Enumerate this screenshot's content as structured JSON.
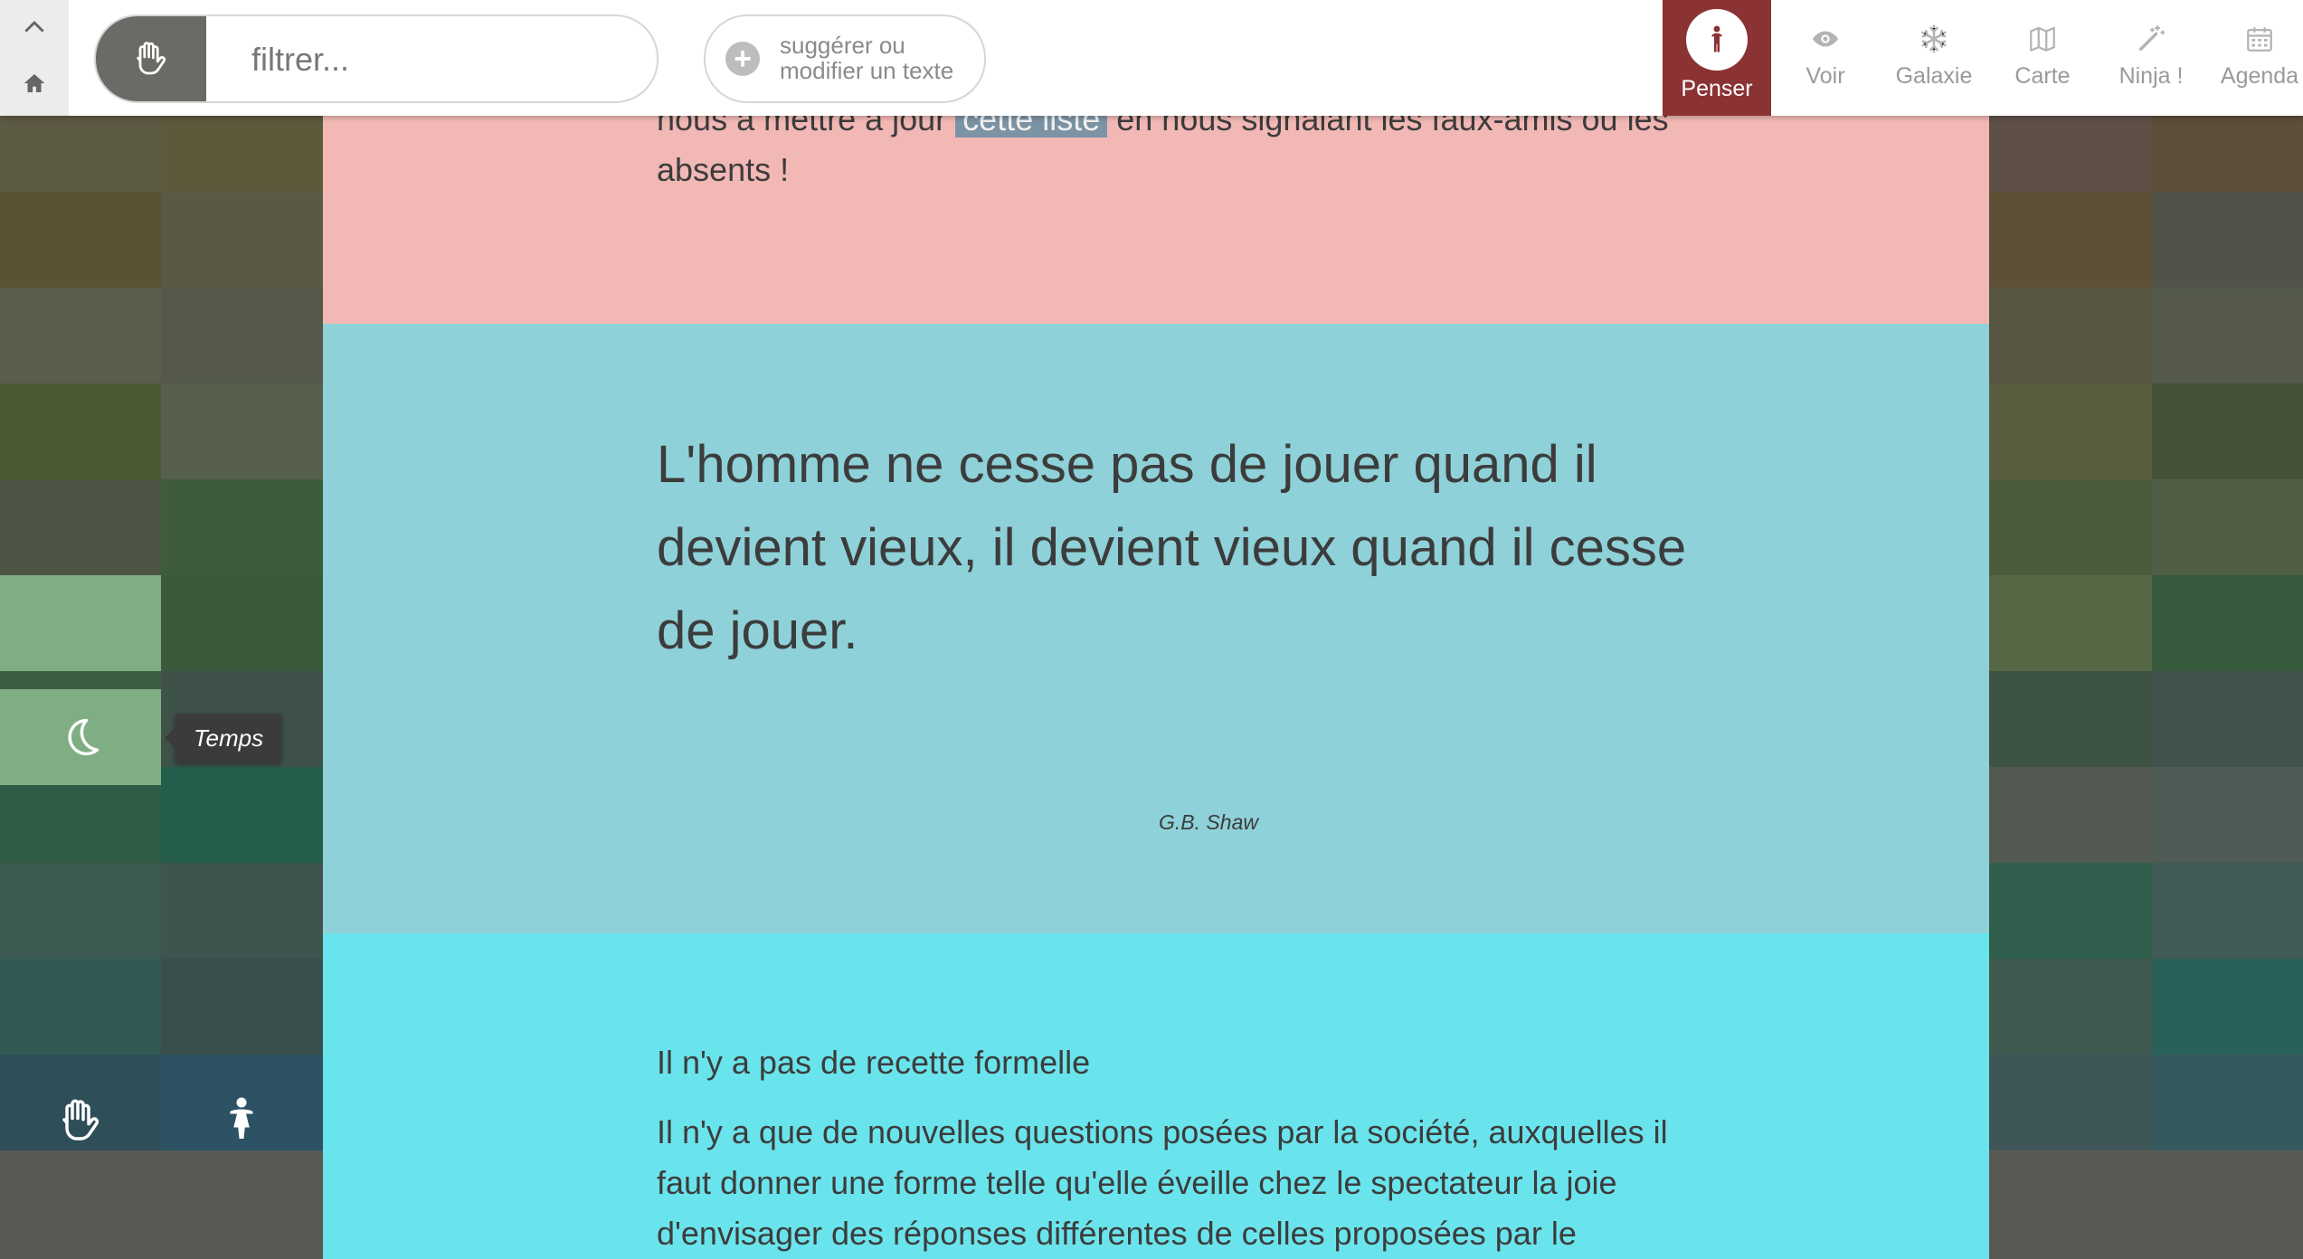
{
  "colors": {
    "nav_active_bg": "#8b3234",
    "section_pink": "#f2b8b5",
    "section_teal": "#8ed1d8",
    "section_cyan": "#6ae4ec",
    "link_highlight": "#7c93a4"
  },
  "mosaic_left": [
    "#5f4a4d",
    "#66553f",
    "#5d5a44",
    "#5c5a3a",
    "#5a5232",
    "#5a5a44",
    "#5b5c4c",
    "#55594a",
    "#495a30",
    "#56604c",
    "#4d5644",
    "#3e5c3c",
    "#7fae84",
    "#3b5a3c",
    "#3e5e44",
    "#3e524a",
    "#2f5c44",
    "#245e4a",
    "#3a5a52",
    "#3f544e",
    "#315a54",
    "#3a4e4e",
    "#2e4e58",
    "#2c5264"
  ],
  "mosaic_right": [
    "#405460",
    "#5a4a62",
    "#5e5048",
    "#5c4e38",
    "#5e5036",
    "#535248",
    "#585640",
    "#555a4a",
    "#5a5e40",
    "#435238",
    "#4b5c3c",
    "#4f5e44",
    "#546846",
    "#385a3c",
    "#3d5442",
    "#40524a",
    "#535a52",
    "#4e5a54",
    "#305e4c",
    "#405a56",
    "#405a50",
    "#28605a",
    "#3f5658",
    "#345a60"
  ],
  "topbar": {
    "search_placeholder": "filtrer...",
    "suggest_label": "suggérer ou\nmodifier un texte",
    "nav": {
      "active": {
        "label": "Penser",
        "icon": "person-icon"
      },
      "items": [
        {
          "label": "Voir",
          "icon": "eye-icon"
        },
        {
          "label": "Galaxie",
          "icon": "snowflake-icon"
        },
        {
          "label": "Carte",
          "icon": "map-icon"
        },
        {
          "label": "Ninja !",
          "icon": "magic-wand-icon"
        },
        {
          "label": "Agenda",
          "icon": "calendar-icon"
        }
      ]
    }
  },
  "sections": {
    "pink": {
      "text_before": "nous à mettre à jour ",
      "link": "cette liste",
      "text_after": " en nous signalant les faux-amis ou les absents !"
    },
    "quote": {
      "text": "L'homme ne cesse pas de jouer quand il devient vieux, il devient vieux quand il cesse de jouer.",
      "author": "G.B. Shaw"
    },
    "article": {
      "title": "Il n'y a pas de recette formelle",
      "body": "Il n'y a que de nouvelles questions posées par la société, auxquelles il faut donner une forme telle qu'elle éveille chez le spectateur la joie d'envisager des réponses différentes de celles proposées par le"
    }
  },
  "sidebar": {
    "tooltip": "Temps"
  }
}
